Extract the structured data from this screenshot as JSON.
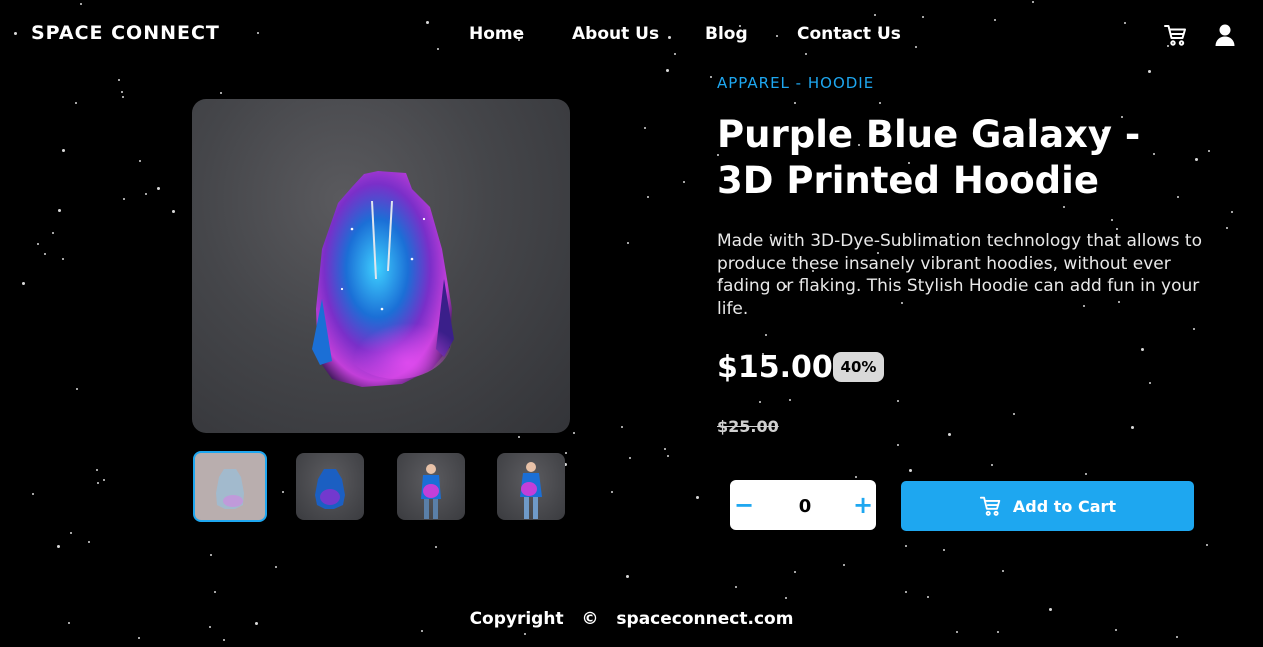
{
  "header": {
    "brand": "SPACE CONNECT",
    "nav": [
      "Home",
      "About Us",
      "Blog",
      "Contact Us"
    ],
    "icons": [
      "cart-icon",
      "user-icon"
    ]
  },
  "product": {
    "category": "APPAREL - HOODIE",
    "title": "Purple Blue Galaxy - 3D Printed Hoodie",
    "description": "Made with 3D-Dye-Sublimation technology that allows to produce these insanely vibrant hoodies, without ever fading or flaking. This Stylish Hoodie can add fun in your life.",
    "price": "$15.00",
    "discount": "40%",
    "original_price": "$25.00",
    "thumbnails": [
      "hoodie-front",
      "hoodie-back",
      "model-front",
      "model-side"
    ]
  },
  "cart": {
    "quantity": "0",
    "minus": "−",
    "plus": "+",
    "add_label": "Add to Cart"
  },
  "footer": {
    "copyright": "Copyright",
    "symbol": "©",
    "site": "spaceconnect.com"
  },
  "colors": {
    "accent": "#1ea7f0",
    "background": "#000000",
    "badge": "#d9d9d9"
  }
}
